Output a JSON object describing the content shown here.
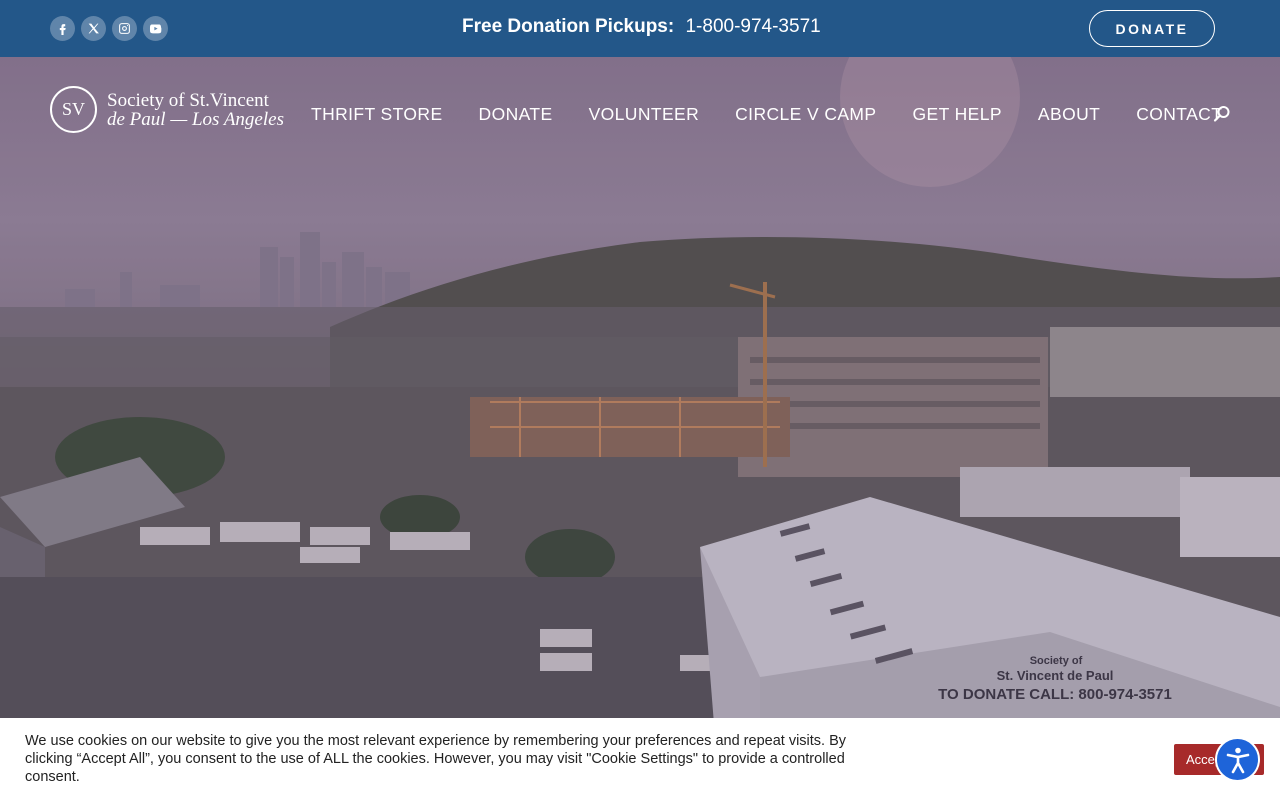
{
  "topbar": {
    "socials": [
      {
        "name": "facebook-icon"
      },
      {
        "name": "x-twitter-icon"
      },
      {
        "name": "instagram-icon"
      },
      {
        "name": "youtube-icon"
      }
    ],
    "pickup_label": "Free Donation Pickups:",
    "pickup_phone": "1-800-974-3571",
    "donate_label": "DONATE"
  },
  "logo": {
    "mark": "SV",
    "line1": "Society of St.Vincent",
    "line2": "de Paul — Los Angeles"
  },
  "nav": {
    "items": [
      "THRIFT STORE",
      "DONATE",
      "VOLUNTEER",
      "CIRCLE V CAMP",
      "GET HELP",
      "ABOUT",
      "CONTACT"
    ],
    "search_icon": "search-icon"
  },
  "hero": {
    "sign_line1": "Society of",
    "sign_line2": "St. Vincent de Paul",
    "sign_line3": "TO DONATE CALL: 800-974-3571"
  },
  "cookie": {
    "text": "We use cookies on our website to give you the most relevant experience by remembering your preferences and repeat visits. By clicking “Accept All”, you consent to the use of ALL the cookies. However, you may visit \"Cookie Settings\" to provide a controlled consent.",
    "accept_label": "Accept All"
  },
  "colors": {
    "topbar": "#235789",
    "accept": "#a72a2a",
    "accessibility": "#1e64d9"
  }
}
